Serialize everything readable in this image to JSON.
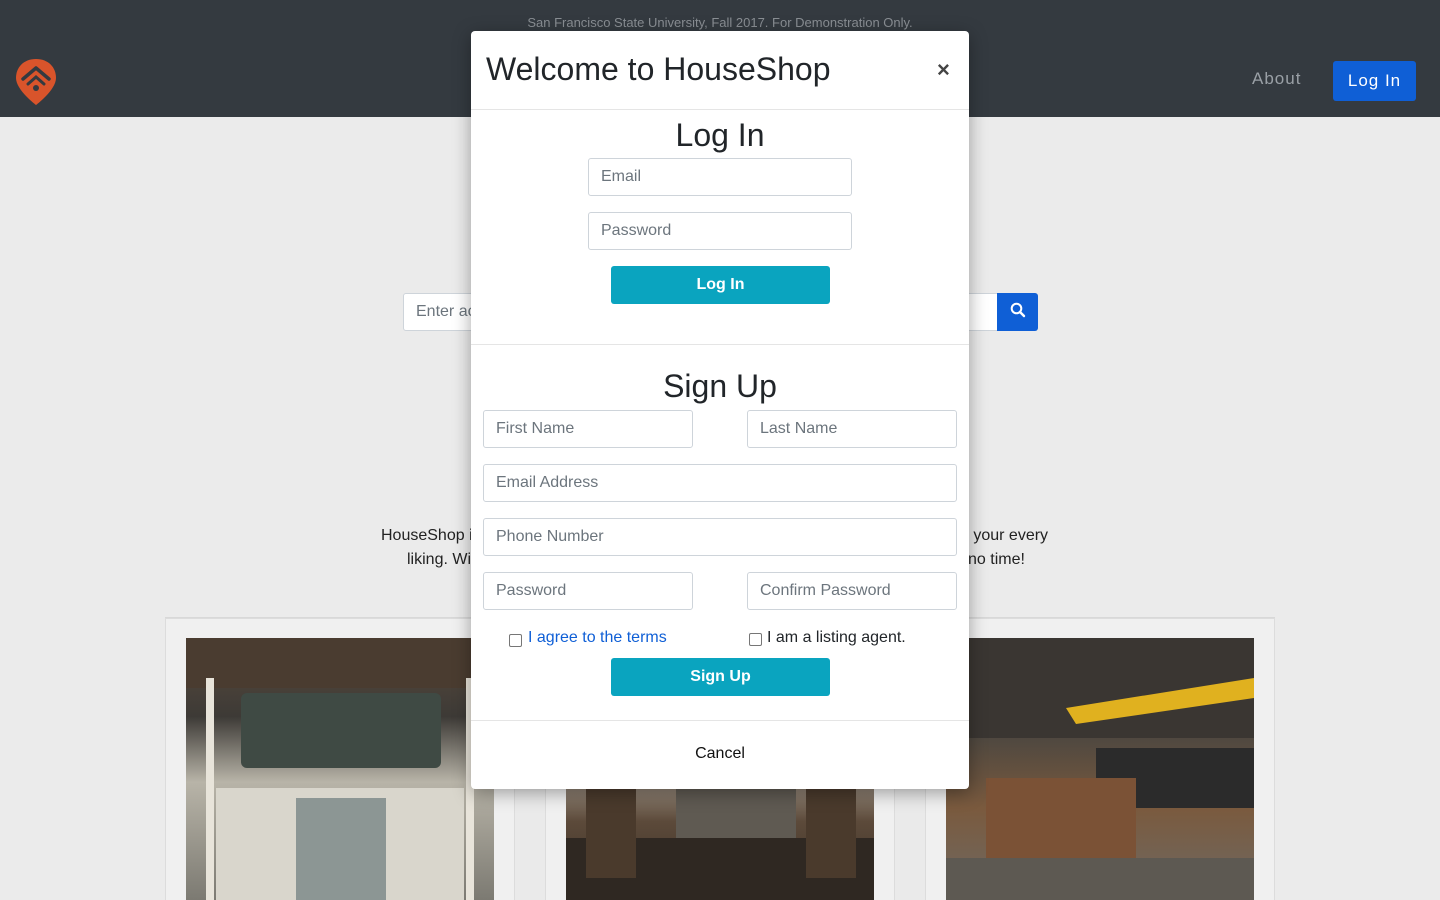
{
  "demo_banner": "San Francisco State University, Fall 2017. For Demonstration Only.",
  "nav": {
    "about": "About",
    "login": "Log In"
  },
  "search": {
    "placeholder": "Enter ac"
  },
  "intro": {
    "line1_start": "HouseShop i",
    "line1_end": "o your every",
    "line2_start": "liking. Wi",
    "line2_end": "no time!"
  },
  "modal": {
    "title": "Welcome to HouseShop",
    "close": "×",
    "login": {
      "heading": "Log In",
      "email_placeholder": "Email",
      "password_placeholder": "Password",
      "button": "Log In"
    },
    "signup": {
      "heading": "Sign Up",
      "first_name_placeholder": "First Name",
      "last_name_placeholder": "Last Name",
      "email_placeholder": "Email Address",
      "phone_placeholder": "Phone Number",
      "password_placeholder": "Password",
      "confirm_placeholder": "Confirm Password",
      "terms_label": "I agree to the terms",
      "agent_label": "I am a listing agent.",
      "button": "Sign Up"
    },
    "cancel": "Cancel"
  },
  "colors": {
    "accent_blue": "#0f5fd6",
    "teal_button": "#0aa4bf",
    "navbar": "#343a40"
  },
  "icons": [
    "logo-house-pin-icon",
    "search-icon",
    "close-icon"
  ]
}
